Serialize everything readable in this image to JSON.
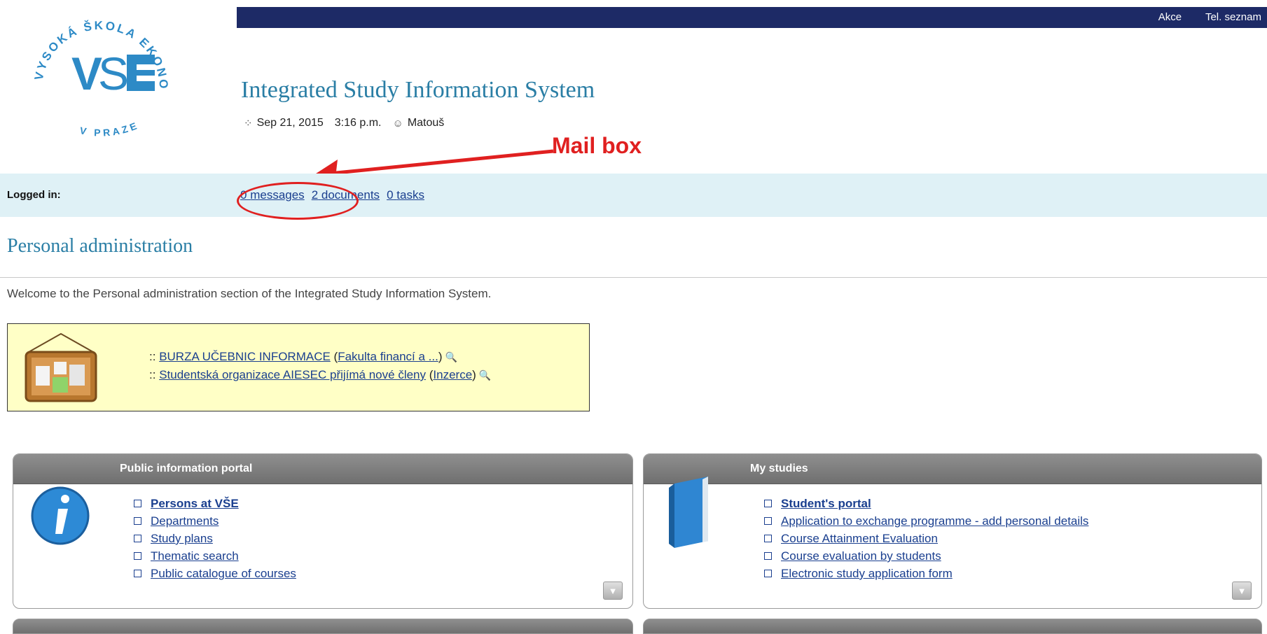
{
  "topbar": {
    "links": [
      "Akce",
      "Tel. seznam"
    ]
  },
  "logo": {
    "text_arc_top": "VYSOKÁ ŠKOLA EKONOMICKÁ",
    "text_arc_bottom": "V PRAZE",
    "mark": "VŠE"
  },
  "header": {
    "title": "Integrated Study Information System",
    "date": "Sep 21, 2015",
    "time": "3:16 p.m.",
    "user": "Matouš"
  },
  "login": {
    "label": "Logged in:",
    "messages_count": "0",
    "messages_label": "messages",
    "documents_count": "2",
    "documents_label": "documents",
    "tasks_count": "0",
    "tasks_label": "tasks"
  },
  "annotation": {
    "label": "Mail box",
    "color": "#e02020"
  },
  "page": {
    "section_title": "Personal administration",
    "welcome": "Welcome to the Personal administration section of the Integrated Study Information System."
  },
  "news": {
    "items": [
      {
        "prefix": "::",
        "title": "BURZA UČEBNIC INFORMACE",
        "source": "Fakulta financí a ..."
      },
      {
        "prefix": "::",
        "title": "Studentská organizace AIESEC přijímá nové členy",
        "source": "Inzerce"
      }
    ]
  },
  "panels": {
    "public": {
      "title": "Public information portal",
      "items": [
        "Persons at VŠE",
        "Departments",
        "Study plans",
        "Thematic search",
        "Public catalogue of courses"
      ]
    },
    "studies": {
      "title": "My studies",
      "items": [
        "Student's portal",
        "Application to exchange programme - add personal details",
        "Course Attainment Evaluation",
        "Course evaluation by students",
        "Electronic study application form"
      ]
    }
  },
  "colors": {
    "topbar": "#1d2a66",
    "title": "#2a7ea5",
    "loginbar": "#dff1f6",
    "news_bg": "#ffffc6",
    "annotation": "#e02020"
  }
}
